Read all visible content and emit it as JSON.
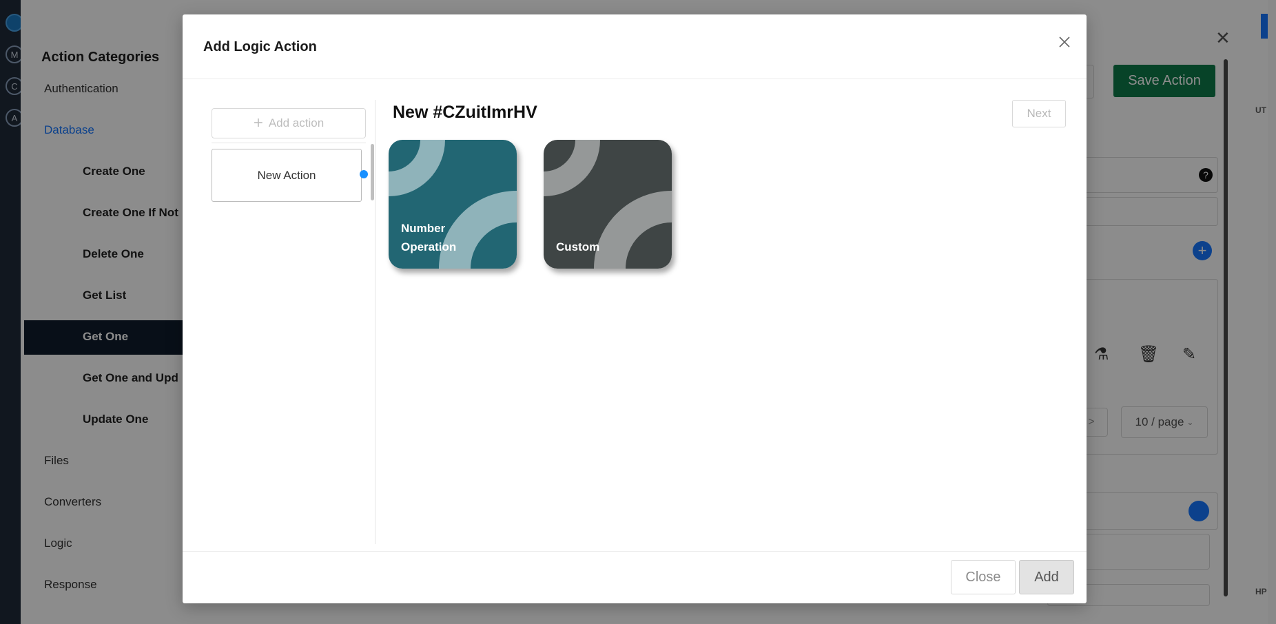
{
  "background": {
    "drawer": {
      "title": "Action Categories",
      "categories": [
        "Authentication",
        "Database",
        "Files",
        "Converters",
        "Logic",
        "Response"
      ],
      "active_category": "Database",
      "database_actions": [
        "Create One",
        "Create One If Not",
        "Delete One",
        "Get List",
        "Get One",
        "Get One and Upd",
        "Update One"
      ],
      "selected_action": "Get One"
    },
    "save_button": "Save Action",
    "close_icon": "close-icon",
    "page_size": "10 / page",
    "pagination_next": ">",
    "help_icon": "?",
    "edge_texts": [
      "UT",
      "HP"
    ],
    "avatar_letters": [
      "M",
      "C",
      "A"
    ]
  },
  "modal": {
    "title": "Add Logic Action",
    "close_icon": "close-icon",
    "add_action_label": "Add action",
    "actions_list": [
      "New Action"
    ],
    "action_heading": "New #CZuitImrHV",
    "next_label": "Next",
    "cards": [
      {
        "label_lines": [
          "Number",
          "Operation"
        ],
        "color": "#226673",
        "accent": "#8fb3ba"
      },
      {
        "label_lines": [
          "Custom"
        ],
        "color": "#3f4545",
        "accent": "#959898"
      }
    ],
    "footer": {
      "close_label": "Close",
      "add_label": "Add"
    }
  },
  "colors": {
    "primary": "#1677ff",
    "save_green": "#0d7a4a",
    "sidebar_dark": "#0f1d2c"
  }
}
